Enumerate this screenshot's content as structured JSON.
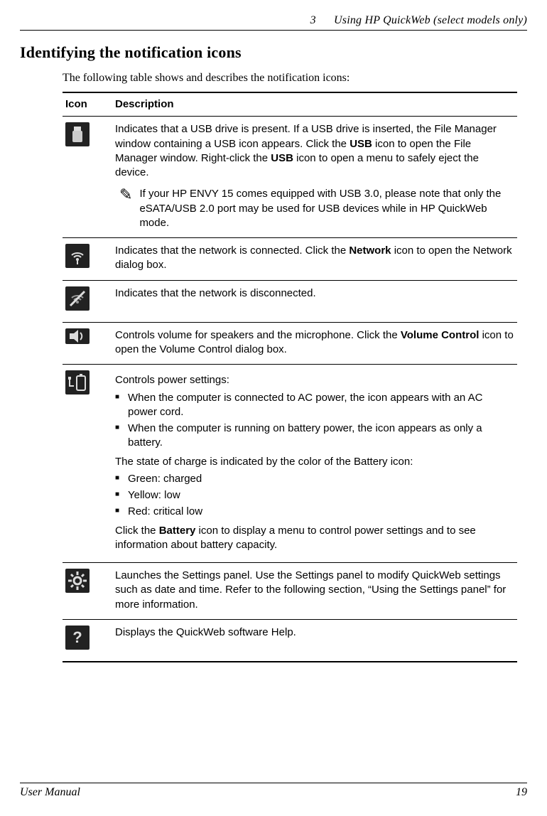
{
  "running_head": {
    "chapter_num": "3",
    "chapter_title": "Using HP QuickWeb (select models only)"
  },
  "section_title": "Identifying the notification icons",
  "intro": "The following table shows and describes the notification icons:",
  "table": {
    "headers": {
      "icon": "Icon",
      "description": "Description"
    },
    "rows": {
      "usb": {
        "text_a": "Indicates that a USB drive is present. If a USB drive is inserted, the File Manager window containing a USB icon appears. Click the ",
        "bold_a": "USB",
        "text_b": " icon to open the File Manager window. Right-click the ",
        "bold_b": "USB",
        "text_c": " icon to open a menu to safely eject the device.",
        "note": "If your HP ENVY 15 comes equipped with USB 3.0, please note that only the eSATA/USB 2.0 port may be used for USB devices while in HP QuickWeb mode."
      },
      "net_on": {
        "text_a": "Indicates that the network is connected. Click the ",
        "bold_a": "Network",
        "text_b": " icon to open the Network dialog box."
      },
      "net_off": {
        "text": "Indicates that the network is disconnected."
      },
      "volume": {
        "text_a": "Controls volume for speakers and the microphone. Click the ",
        "bold_a": "Volume Control",
        "text_b": " icon to open the Volume Control dialog box."
      },
      "power": {
        "lead": "Controls power settings:",
        "b1": "When the computer is connected to AC power, the icon appears with an AC power cord.",
        "b2": "When the computer is running on battery power, the icon appears as only a battery.",
        "mid": "The state of charge is indicated by the color of the Battery icon:",
        "c1": "Green: charged",
        "c2": "Yellow: low",
        "c3": "Red: critical low",
        "trail_a": "Click the ",
        "trail_bold": "Battery",
        "trail_b": " icon to display a menu to control power settings and to see information about battery capacity."
      },
      "settings": {
        "text": "Launches the Settings panel. Use the Settings panel to modify QuickWeb settings such as date and time. Refer to the following section, “Using the Settings panel” for more information."
      },
      "help": {
        "text": "Displays the QuickWeb software Help."
      }
    }
  },
  "footer": {
    "left": "User Manual",
    "right": "19"
  }
}
